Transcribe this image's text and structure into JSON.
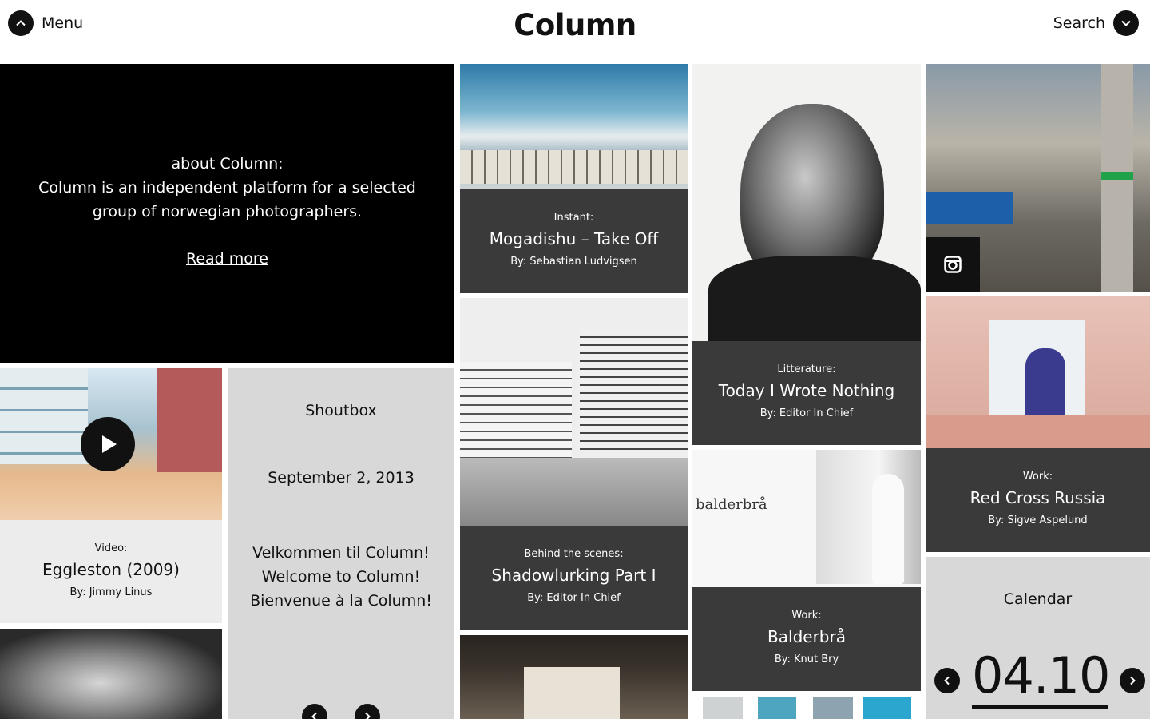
{
  "header": {
    "menu_label": "Menu",
    "logo": "Column",
    "search_label": "Search"
  },
  "about": {
    "heading": "about Column:",
    "body": "Column is an independent platform for a selected group of norwegian photographers.",
    "link": "Read more"
  },
  "posts": [
    {
      "category": "Instant:",
      "title": "Mogadishu – Take Off",
      "byline": "By: Sebastian Ludvigsen"
    },
    {
      "category": "Litterature:",
      "title": "Today I Wrote Nothing",
      "byline": "By: Editor In Chief"
    },
    {
      "category": "Work:",
      "title": "Red Cross Russia",
      "byline": "By: Sigve Aspelund"
    },
    {
      "category": "Video:",
      "title": "Eggleston (2009)",
      "byline": "By: Jimmy Linus"
    },
    {
      "category": "Behind the scenes:",
      "title": "Shadowlurking Part I",
      "byline": "By: Editor In Chief"
    },
    {
      "category": "Work:",
      "title": "Balderbrå",
      "byline": "By: Knut Bry"
    }
  ],
  "shoutbox": {
    "heading": "Shoutbox",
    "date": "September 2, 2013",
    "messages": [
      "Velkommen til Column!",
      "Welcome to Column!",
      "Bienvenue à la Column!"
    ]
  },
  "calendar": {
    "heading": "Calendar",
    "date": "04.10"
  },
  "balderbra_book_title": "balderbrå",
  "icons": [
    "chevron-up-icon",
    "chevron-down-icon",
    "play-icon",
    "instagram-icon",
    "chevron-left-icon",
    "chevron-right-icon"
  ]
}
